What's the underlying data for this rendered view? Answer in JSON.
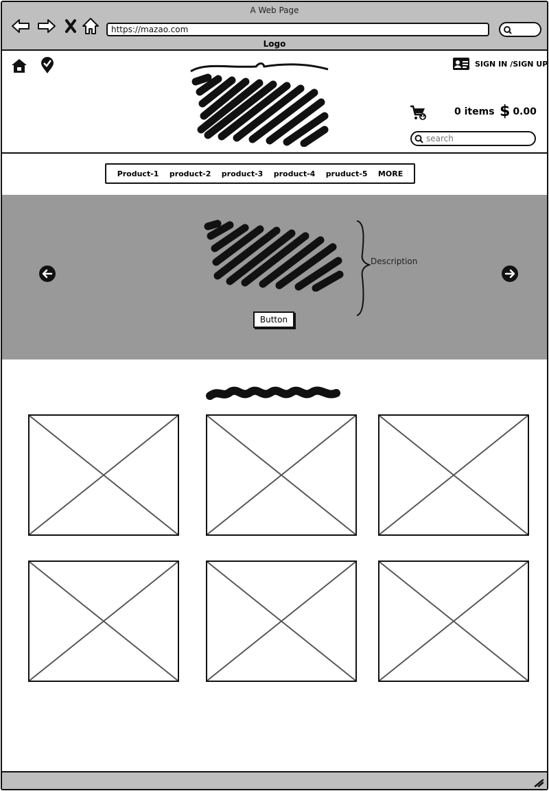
{
  "chrome": {
    "title": "A Web Page",
    "url": "https://mazao.com",
    "logo_label": "Logo"
  },
  "header": {
    "sign_in_label": "SIGN IN /SIGN UP",
    "cart_items": "0 items",
    "cart_total": "0.00",
    "currency_symbol": "$",
    "search_placeholder": "search"
  },
  "nav": {
    "items": [
      "Product-1",
      "product-2",
      "product-3",
      "product-4",
      "pruduct-5",
      "MORE"
    ]
  },
  "hero": {
    "description": "Description",
    "button_label": "Button"
  },
  "icons": {
    "back": "back-arrow-icon",
    "forward": "forward-arrow-icon",
    "stop": "close-icon",
    "home": "home-icon",
    "check": "check-badge-icon",
    "id_card": "id-card-icon",
    "cart": "cart-icon",
    "search": "search-icon",
    "prev": "arrow-left-circle-icon",
    "next": "arrow-right-circle-icon"
  },
  "colors": {
    "chrome_bg": "#bfbfbf",
    "hero_bg": "#999999",
    "ink": "#111111"
  }
}
